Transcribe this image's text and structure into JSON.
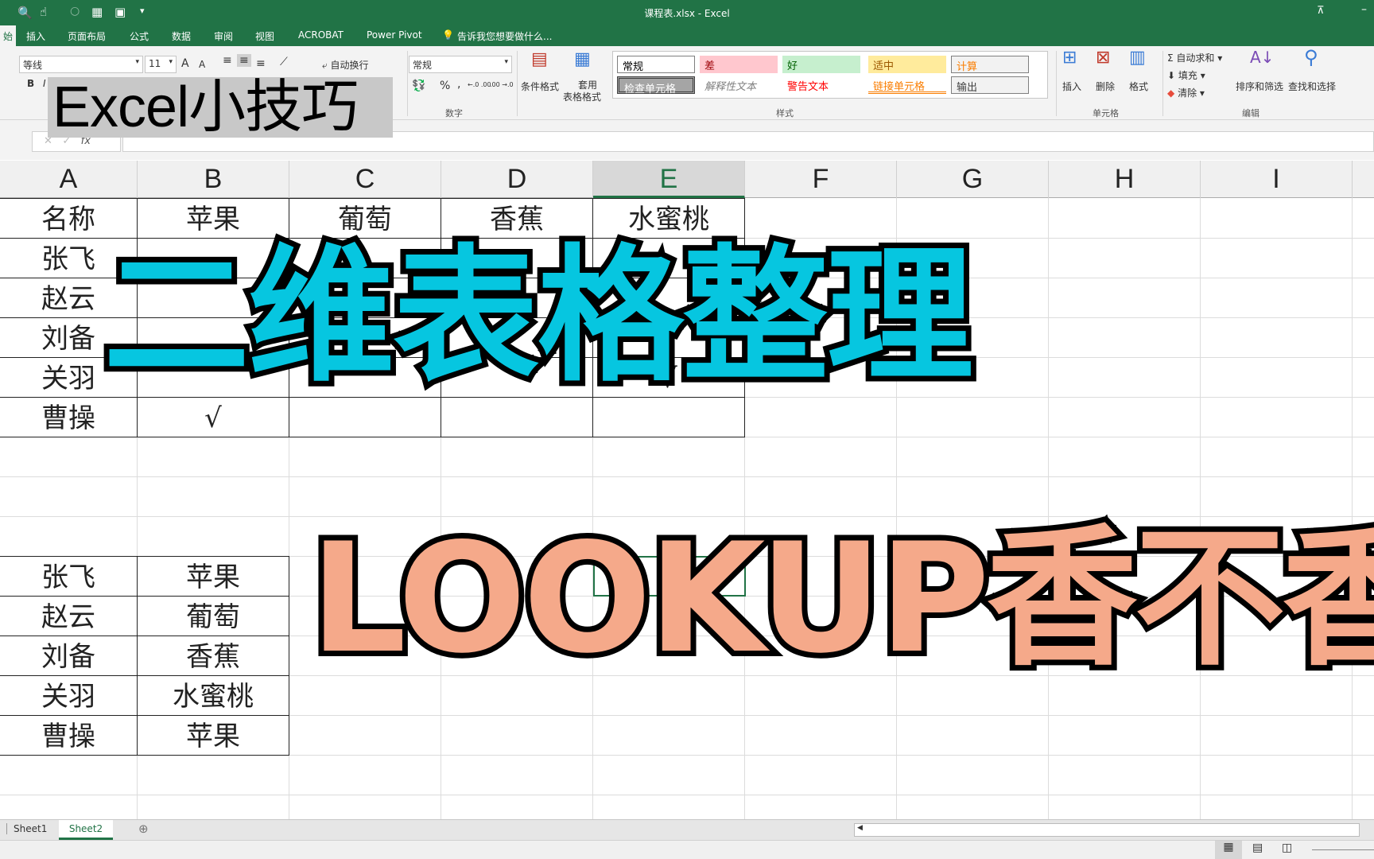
{
  "window": {
    "title": "课程表.xlsx - Excel"
  },
  "ribbon_tabs": [
    "始",
    "插入",
    "页面布局",
    "公式",
    "数据",
    "审阅",
    "视图",
    "ACROBAT",
    "Power Pivot",
    "告诉我您想要做什么..."
  ],
  "ribbon": {
    "font_name": "等线",
    "font_size": "11",
    "grow": "A",
    "shrink": "A",
    "bold": "B",
    "italic": "I",
    "wrap_text": "自动换行",
    "number_format": "常规",
    "percent": "%",
    "comma": ",",
    "inc_dec": "←.0 .00",
    "dec_dec": ".00 →.0",
    "conditional_format": "条件格式",
    "format_table_1": "套用",
    "format_table_2": "表格格式",
    "styles": [
      {
        "label": "常规",
        "bg": "#ffffff",
        "fg": "#000000"
      },
      {
        "label": "差",
        "bg": "#ffc7ce",
        "fg": "#9c0006"
      },
      {
        "label": "好",
        "bg": "#c6efce",
        "fg": "#006100"
      },
      {
        "label": "适中",
        "bg": "#ffeb9c",
        "fg": "#9c5700"
      },
      {
        "label": "计算",
        "bg": "#f2f2f2",
        "fg": "#fa7d00"
      },
      {
        "label": "检查单元格",
        "bg": "#a5a5a5",
        "fg": "#ffffff"
      },
      {
        "label": "解释性文本",
        "bg": "#ffffff",
        "fg": "#7f7f7f"
      },
      {
        "label": "警告文本",
        "bg": "#ffffff",
        "fg": "#ff0000"
      },
      {
        "label": "链接单元格",
        "bg": "#ffffff",
        "fg": "#fa7d00"
      },
      {
        "label": "输出",
        "bg": "#f2f2f2",
        "fg": "#3f3f3f"
      }
    ],
    "insert": "插入",
    "delete": "删除",
    "format": "格式",
    "autosum": "自动求和",
    "fill": "填充",
    "clear": "清除",
    "sort_filter": "排序和筛选",
    "find_select": "查找和选择",
    "groups": {
      "number": "数字",
      "styles": "样式",
      "cells": "单元格",
      "editing": "编辑"
    }
  },
  "formula_bar": {
    "fx": "fx",
    "cancel": "✕",
    "enter": "✓",
    "value": ""
  },
  "columns": [
    "A",
    "B",
    "C",
    "D",
    "E",
    "F",
    "G",
    "H",
    "I"
  ],
  "selected_column": "E",
  "table1": {
    "header": [
      "名称",
      "苹果",
      "葡萄",
      "香蕉",
      "水蜜桃"
    ],
    "rows": [
      [
        "张飞",
        "",
        "",
        "",
        ""
      ],
      [
        "赵云",
        "",
        "",
        "",
        ""
      ],
      [
        "刘备",
        "",
        "",
        "",
        ""
      ],
      [
        "关羽",
        "",
        "",
        "",
        "√"
      ],
      [
        "曹操",
        "√",
        "",
        "",
        ""
      ]
    ]
  },
  "table2": [
    [
      "张飞",
      "苹果"
    ],
    [
      "赵云",
      "葡萄"
    ],
    [
      "刘备",
      "香蕉"
    ],
    [
      "关羽",
      "水蜜桃"
    ],
    [
      "曹操",
      "苹果"
    ]
  ],
  "overlays": {
    "badge": "Excel小技巧",
    "headline": "二维表格整理",
    "subheadline": "LOOKUP香不香"
  },
  "sheets": [
    {
      "name": "Sheet1",
      "active": false
    },
    {
      "name": "Sheet2",
      "active": true
    }
  ]
}
